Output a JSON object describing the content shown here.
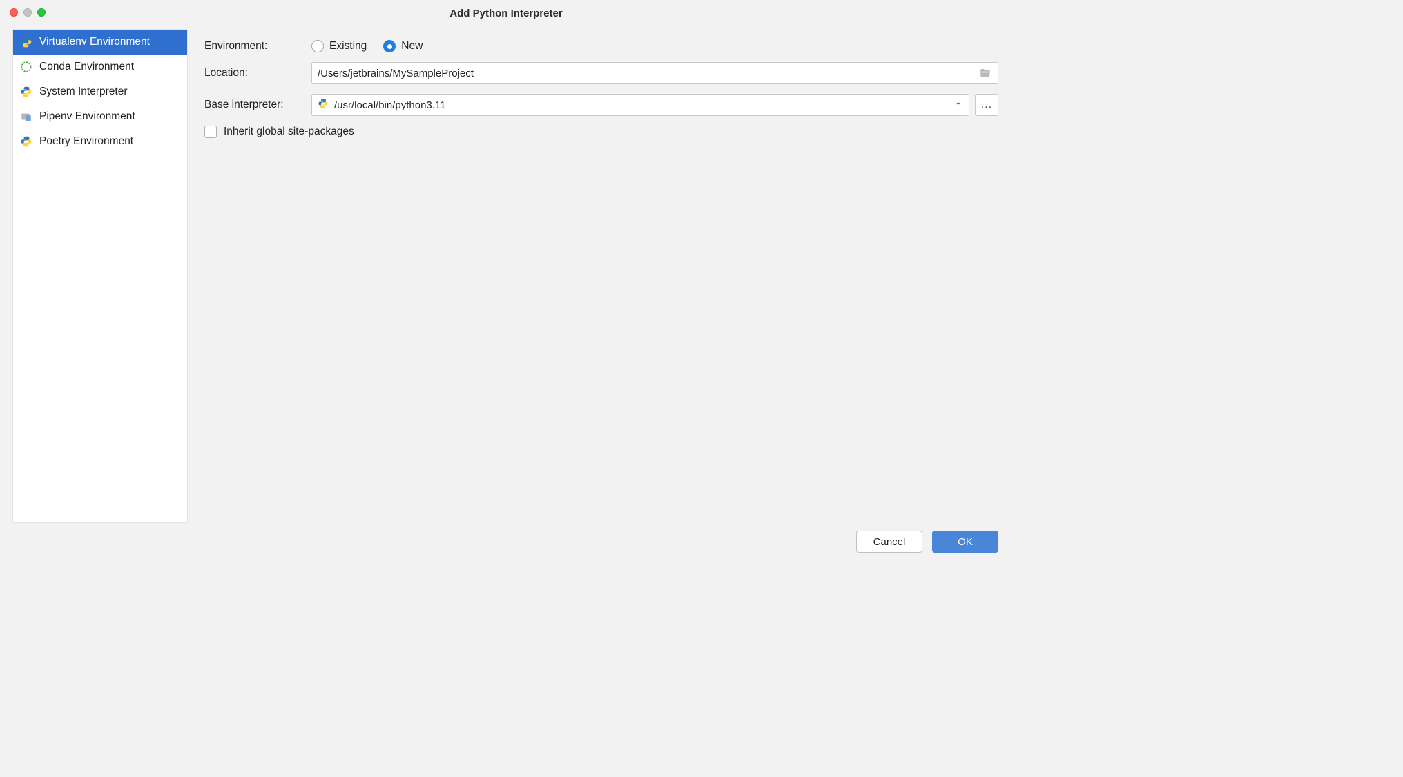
{
  "title": "Add Python Interpreter",
  "sidebar": {
    "items": [
      {
        "label": "Virtualenv Environment",
        "selected": true,
        "icon": "python"
      },
      {
        "label": "Conda Environment",
        "selected": false,
        "icon": "conda"
      },
      {
        "label": "System Interpreter",
        "selected": false,
        "icon": "python"
      },
      {
        "label": "Pipenv Environment",
        "selected": false,
        "icon": "pipenv"
      },
      {
        "label": "Poetry Environment",
        "selected": false,
        "icon": "python"
      }
    ]
  },
  "form": {
    "environment_label": "Environment:",
    "radio_existing": "Existing",
    "radio_new": "New",
    "radio_selected": "New",
    "location_label": "Location:",
    "location_value": "/Users/jetbrains/MySampleProject",
    "base_interpreter_label": "Base interpreter:",
    "base_interpreter_value": "/usr/local/bin/python3.11",
    "browse_label": "...",
    "inherit_label": "Inherit global site-packages",
    "inherit_checked": false
  },
  "footer": {
    "cancel": "Cancel",
    "ok": "OK"
  }
}
